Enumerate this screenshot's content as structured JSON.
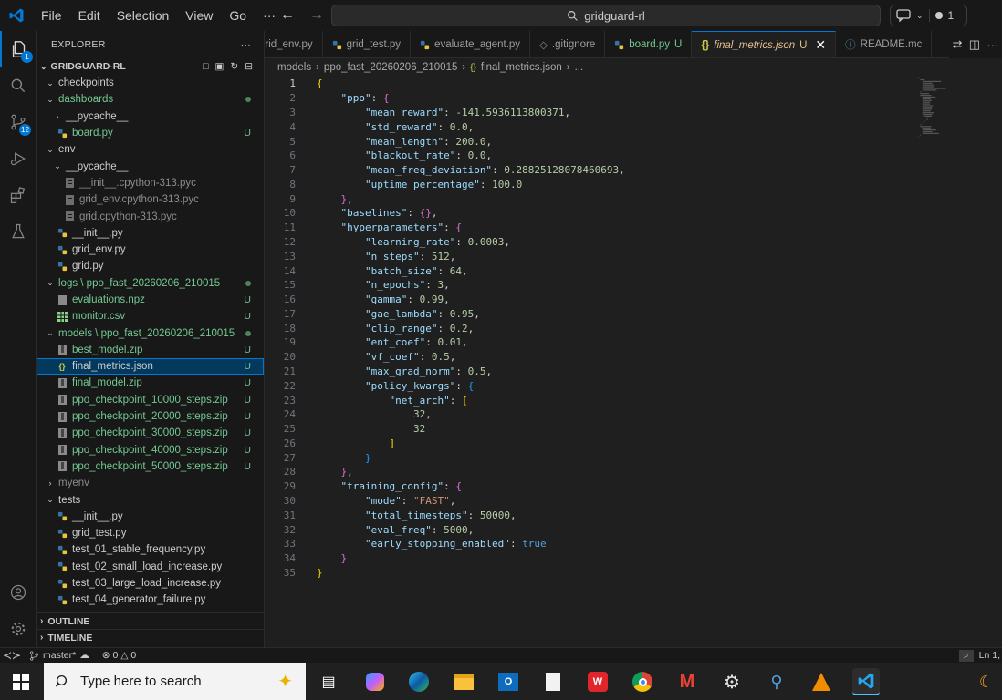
{
  "menu": {
    "file": "File",
    "edit": "Edit",
    "selection": "Selection",
    "view": "View",
    "go": "Go",
    "more": "···"
  },
  "search": {
    "text": "gridguard-rl"
  },
  "copilot": {
    "count": "1"
  },
  "activity": {
    "scm_badge": "12",
    "explorer_badge": "1"
  },
  "explorer": {
    "title": "EXPLORER",
    "root": "GRIDGUARD-RL",
    "items": [
      {
        "label": "checkpoints",
        "indent": 0,
        "type": "folder-open",
        "status": ""
      },
      {
        "label": "dashboards",
        "indent": 0,
        "type": "folder-open",
        "status": "dot",
        "color": "green"
      },
      {
        "label": "__pycache__",
        "indent": 1,
        "type": "folder-closed",
        "status": ""
      },
      {
        "label": "board.py",
        "indent": 1,
        "type": "py",
        "status": "U",
        "color": "green"
      },
      {
        "label": "env",
        "indent": 0,
        "type": "folder-open",
        "status": ""
      },
      {
        "label": "__pycache__",
        "indent": 1,
        "type": "folder-open",
        "status": ""
      },
      {
        "label": "__init__.cpython-313.pyc",
        "indent": 2,
        "type": "pyc",
        "status": "",
        "color": "dim"
      },
      {
        "label": "grid_env.cpython-313.pyc",
        "indent": 2,
        "type": "pyc",
        "status": "",
        "color": "dim"
      },
      {
        "label": "grid.cpython-313.pyc",
        "indent": 2,
        "type": "pyc",
        "status": "",
        "color": "dim"
      },
      {
        "label": "__init__.py",
        "indent": 1,
        "type": "py",
        "status": ""
      },
      {
        "label": "grid_env.py",
        "indent": 1,
        "type": "py",
        "status": ""
      },
      {
        "label": "grid.py",
        "indent": 1,
        "type": "py",
        "status": ""
      },
      {
        "label": "logs \\ ppo_fast_20260206_210015",
        "indent": 0,
        "type": "folder-open",
        "status": "dot",
        "color": "green"
      },
      {
        "label": "evaluations.npz",
        "indent": 1,
        "type": "bin",
        "status": "U",
        "color": "green"
      },
      {
        "label": "monitor.csv",
        "indent": 1,
        "type": "csv",
        "status": "U",
        "color": "green"
      },
      {
        "label": "models \\ ppo_fast_20260206_210015",
        "indent": 0,
        "type": "folder-open",
        "status": "dot",
        "color": "green"
      },
      {
        "label": "best_model.zip",
        "indent": 1,
        "type": "zip",
        "status": "U",
        "color": "green"
      },
      {
        "label": "final_metrics.json",
        "indent": 1,
        "type": "json",
        "status": "U",
        "color": "white",
        "selected": true
      },
      {
        "label": "final_model.zip",
        "indent": 1,
        "type": "zip",
        "status": "U",
        "color": "green"
      },
      {
        "label": "ppo_checkpoint_10000_steps.zip",
        "indent": 1,
        "type": "zip",
        "status": "U",
        "color": "green"
      },
      {
        "label": "ppo_checkpoint_20000_steps.zip",
        "indent": 1,
        "type": "zip",
        "status": "U",
        "color": "green"
      },
      {
        "label": "ppo_checkpoint_30000_steps.zip",
        "indent": 1,
        "type": "zip",
        "status": "U",
        "color": "green"
      },
      {
        "label": "ppo_checkpoint_40000_steps.zip",
        "indent": 1,
        "type": "zip",
        "status": "U",
        "color": "green"
      },
      {
        "label": "ppo_checkpoint_50000_steps.zip",
        "indent": 1,
        "type": "zip",
        "status": "U",
        "color": "green"
      },
      {
        "label": "myenv",
        "indent": 0,
        "type": "folder-closed",
        "status": "",
        "color": "dim"
      },
      {
        "label": "tests",
        "indent": 0,
        "type": "folder-open",
        "status": ""
      },
      {
        "label": "__init__.py",
        "indent": 1,
        "type": "py",
        "status": ""
      },
      {
        "label": "grid_test.py",
        "indent": 1,
        "type": "py",
        "status": ""
      },
      {
        "label": "test_01_stable_frequency.py",
        "indent": 1,
        "type": "py",
        "status": ""
      },
      {
        "label": "test_02_small_load_increase.py",
        "indent": 1,
        "type": "py",
        "status": ""
      },
      {
        "label": "test_03_large_load_increase.py",
        "indent": 1,
        "type": "py",
        "status": ""
      },
      {
        "label": "test_04_generator_failure.py",
        "indent": 1,
        "type": "py",
        "status": ""
      }
    ],
    "outline": "OUTLINE",
    "timeline": "TIMELINE"
  },
  "tabs": [
    {
      "label": "grid_env.py",
      "type": "py",
      "status": ""
    },
    {
      "label": "grid_test.py",
      "type": "py",
      "status": ""
    },
    {
      "label": "evaluate_agent.py",
      "type": "py",
      "status": ""
    },
    {
      "label": ".gitignore",
      "type": "git",
      "status": ""
    },
    {
      "label": "board.py",
      "type": "py",
      "status": "U"
    },
    {
      "label": "final_metrics.json",
      "type": "json",
      "status": "U",
      "active": true
    },
    {
      "label": "README.mc",
      "type": "info",
      "status": ""
    }
  ],
  "breadcrumb": [
    "models",
    "ppo_fast_20260206_210015",
    "final_metrics.json",
    "..."
  ],
  "code_lines": [
    [
      [
        "b1",
        "{"
      ]
    ],
    [
      [
        "sp",
        "    "
      ],
      [
        "k",
        "\"ppo\""
      ],
      [
        "p",
        ": "
      ],
      [
        "b2",
        "{"
      ]
    ],
    [
      [
        "sp",
        "        "
      ],
      [
        "k",
        "\"mean_reward\""
      ],
      [
        "p",
        ": "
      ],
      [
        "n",
        "-141.5936113800371"
      ],
      [
        "p",
        ","
      ]
    ],
    [
      [
        "sp",
        "        "
      ],
      [
        "k",
        "\"std_reward\""
      ],
      [
        "p",
        ": "
      ],
      [
        "n",
        "0.0"
      ],
      [
        "p",
        ","
      ]
    ],
    [
      [
        "sp",
        "        "
      ],
      [
        "k",
        "\"mean_length\""
      ],
      [
        "p",
        ": "
      ],
      [
        "n",
        "200.0"
      ],
      [
        "p",
        ","
      ]
    ],
    [
      [
        "sp",
        "        "
      ],
      [
        "k",
        "\"blackout_rate\""
      ],
      [
        "p",
        ": "
      ],
      [
        "n",
        "0.0"
      ],
      [
        "p",
        ","
      ]
    ],
    [
      [
        "sp",
        "        "
      ],
      [
        "k",
        "\"mean_freq_deviation\""
      ],
      [
        "p",
        ": "
      ],
      [
        "n",
        "0.28825128078460693"
      ],
      [
        "p",
        ","
      ]
    ],
    [
      [
        "sp",
        "        "
      ],
      [
        "k",
        "\"uptime_percentage\""
      ],
      [
        "p",
        ": "
      ],
      [
        "n",
        "100.0"
      ]
    ],
    [
      [
        "sp",
        "    "
      ],
      [
        "b2",
        "}"
      ],
      [
        "p",
        ","
      ]
    ],
    [
      [
        "sp",
        "    "
      ],
      [
        "k",
        "\"baselines\""
      ],
      [
        "p",
        ": "
      ],
      [
        "b2",
        "{}"
      ],
      [
        "p",
        ","
      ]
    ],
    [
      [
        "sp",
        "    "
      ],
      [
        "k",
        "\"hyperparameters\""
      ],
      [
        "p",
        ": "
      ],
      [
        "b2",
        "{"
      ]
    ],
    [
      [
        "sp",
        "        "
      ],
      [
        "k",
        "\"learning_rate\""
      ],
      [
        "p",
        ": "
      ],
      [
        "n",
        "0.0003"
      ],
      [
        "p",
        ","
      ]
    ],
    [
      [
        "sp",
        "        "
      ],
      [
        "k",
        "\"n_steps\""
      ],
      [
        "p",
        ": "
      ],
      [
        "n",
        "512"
      ],
      [
        "p",
        ","
      ]
    ],
    [
      [
        "sp",
        "        "
      ],
      [
        "k",
        "\"batch_size\""
      ],
      [
        "p",
        ": "
      ],
      [
        "n",
        "64"
      ],
      [
        "p",
        ","
      ]
    ],
    [
      [
        "sp",
        "        "
      ],
      [
        "k",
        "\"n_epochs\""
      ],
      [
        "p",
        ": "
      ],
      [
        "n",
        "3"
      ],
      [
        "p",
        ","
      ]
    ],
    [
      [
        "sp",
        "        "
      ],
      [
        "k",
        "\"gamma\""
      ],
      [
        "p",
        ": "
      ],
      [
        "n",
        "0.99"
      ],
      [
        "p",
        ","
      ]
    ],
    [
      [
        "sp",
        "        "
      ],
      [
        "k",
        "\"gae_lambda\""
      ],
      [
        "p",
        ": "
      ],
      [
        "n",
        "0.95"
      ],
      [
        "p",
        ","
      ]
    ],
    [
      [
        "sp",
        "        "
      ],
      [
        "k",
        "\"clip_range\""
      ],
      [
        "p",
        ": "
      ],
      [
        "n",
        "0.2"
      ],
      [
        "p",
        ","
      ]
    ],
    [
      [
        "sp",
        "        "
      ],
      [
        "k",
        "\"ent_coef\""
      ],
      [
        "p",
        ": "
      ],
      [
        "n",
        "0.01"
      ],
      [
        "p",
        ","
      ]
    ],
    [
      [
        "sp",
        "        "
      ],
      [
        "k",
        "\"vf_coef\""
      ],
      [
        "p",
        ": "
      ],
      [
        "n",
        "0.5"
      ],
      [
        "p",
        ","
      ]
    ],
    [
      [
        "sp",
        "        "
      ],
      [
        "k",
        "\"max_grad_norm\""
      ],
      [
        "p",
        ": "
      ],
      [
        "n",
        "0.5"
      ],
      [
        "p",
        ","
      ]
    ],
    [
      [
        "sp",
        "        "
      ],
      [
        "k",
        "\"policy_kwargs\""
      ],
      [
        "p",
        ": "
      ],
      [
        "b3",
        "{"
      ]
    ],
    [
      [
        "sp",
        "            "
      ],
      [
        "k",
        "\"net_arch\""
      ],
      [
        "p",
        ": "
      ],
      [
        "b1",
        "["
      ]
    ],
    [
      [
        "sp",
        "                "
      ],
      [
        "n",
        "32"
      ],
      [
        "p",
        ","
      ]
    ],
    [
      [
        "sp",
        "                "
      ],
      [
        "n",
        "32"
      ]
    ],
    [
      [
        "sp",
        "            "
      ],
      [
        "b1",
        "]"
      ]
    ],
    [
      [
        "sp",
        "        "
      ],
      [
        "b3",
        "}"
      ]
    ],
    [
      [
        "sp",
        "    "
      ],
      [
        "b2",
        "}"
      ],
      [
        "p",
        ","
      ]
    ],
    [
      [
        "sp",
        "    "
      ],
      [
        "k",
        "\"training_config\""
      ],
      [
        "p",
        ": "
      ],
      [
        "b2",
        "{"
      ]
    ],
    [
      [
        "sp",
        "        "
      ],
      [
        "k",
        "\"mode\""
      ],
      [
        "p",
        ": "
      ],
      [
        "s",
        "\"FAST\""
      ],
      [
        "p",
        ","
      ]
    ],
    [
      [
        "sp",
        "        "
      ],
      [
        "k",
        "\"total_timesteps\""
      ],
      [
        "p",
        ": "
      ],
      [
        "n",
        "50000"
      ],
      [
        "p",
        ","
      ]
    ],
    [
      [
        "sp",
        "        "
      ],
      [
        "k",
        "\"eval_freq\""
      ],
      [
        "p",
        ": "
      ],
      [
        "n",
        "5000"
      ],
      [
        "p",
        ","
      ]
    ],
    [
      [
        "sp",
        "        "
      ],
      [
        "k",
        "\"early_stopping_enabled\""
      ],
      [
        "p",
        ": "
      ],
      [
        "kw",
        "true"
      ]
    ],
    [
      [
        "sp",
        "    "
      ],
      [
        "b2",
        "}"
      ]
    ],
    [
      [
        "b1",
        "}"
      ]
    ]
  ],
  "status": {
    "branch": "master*",
    "errors": "0",
    "warnings": "0",
    "position": "Ln 1,"
  },
  "taskbar": {
    "search_placeholder": "Type here to search"
  }
}
